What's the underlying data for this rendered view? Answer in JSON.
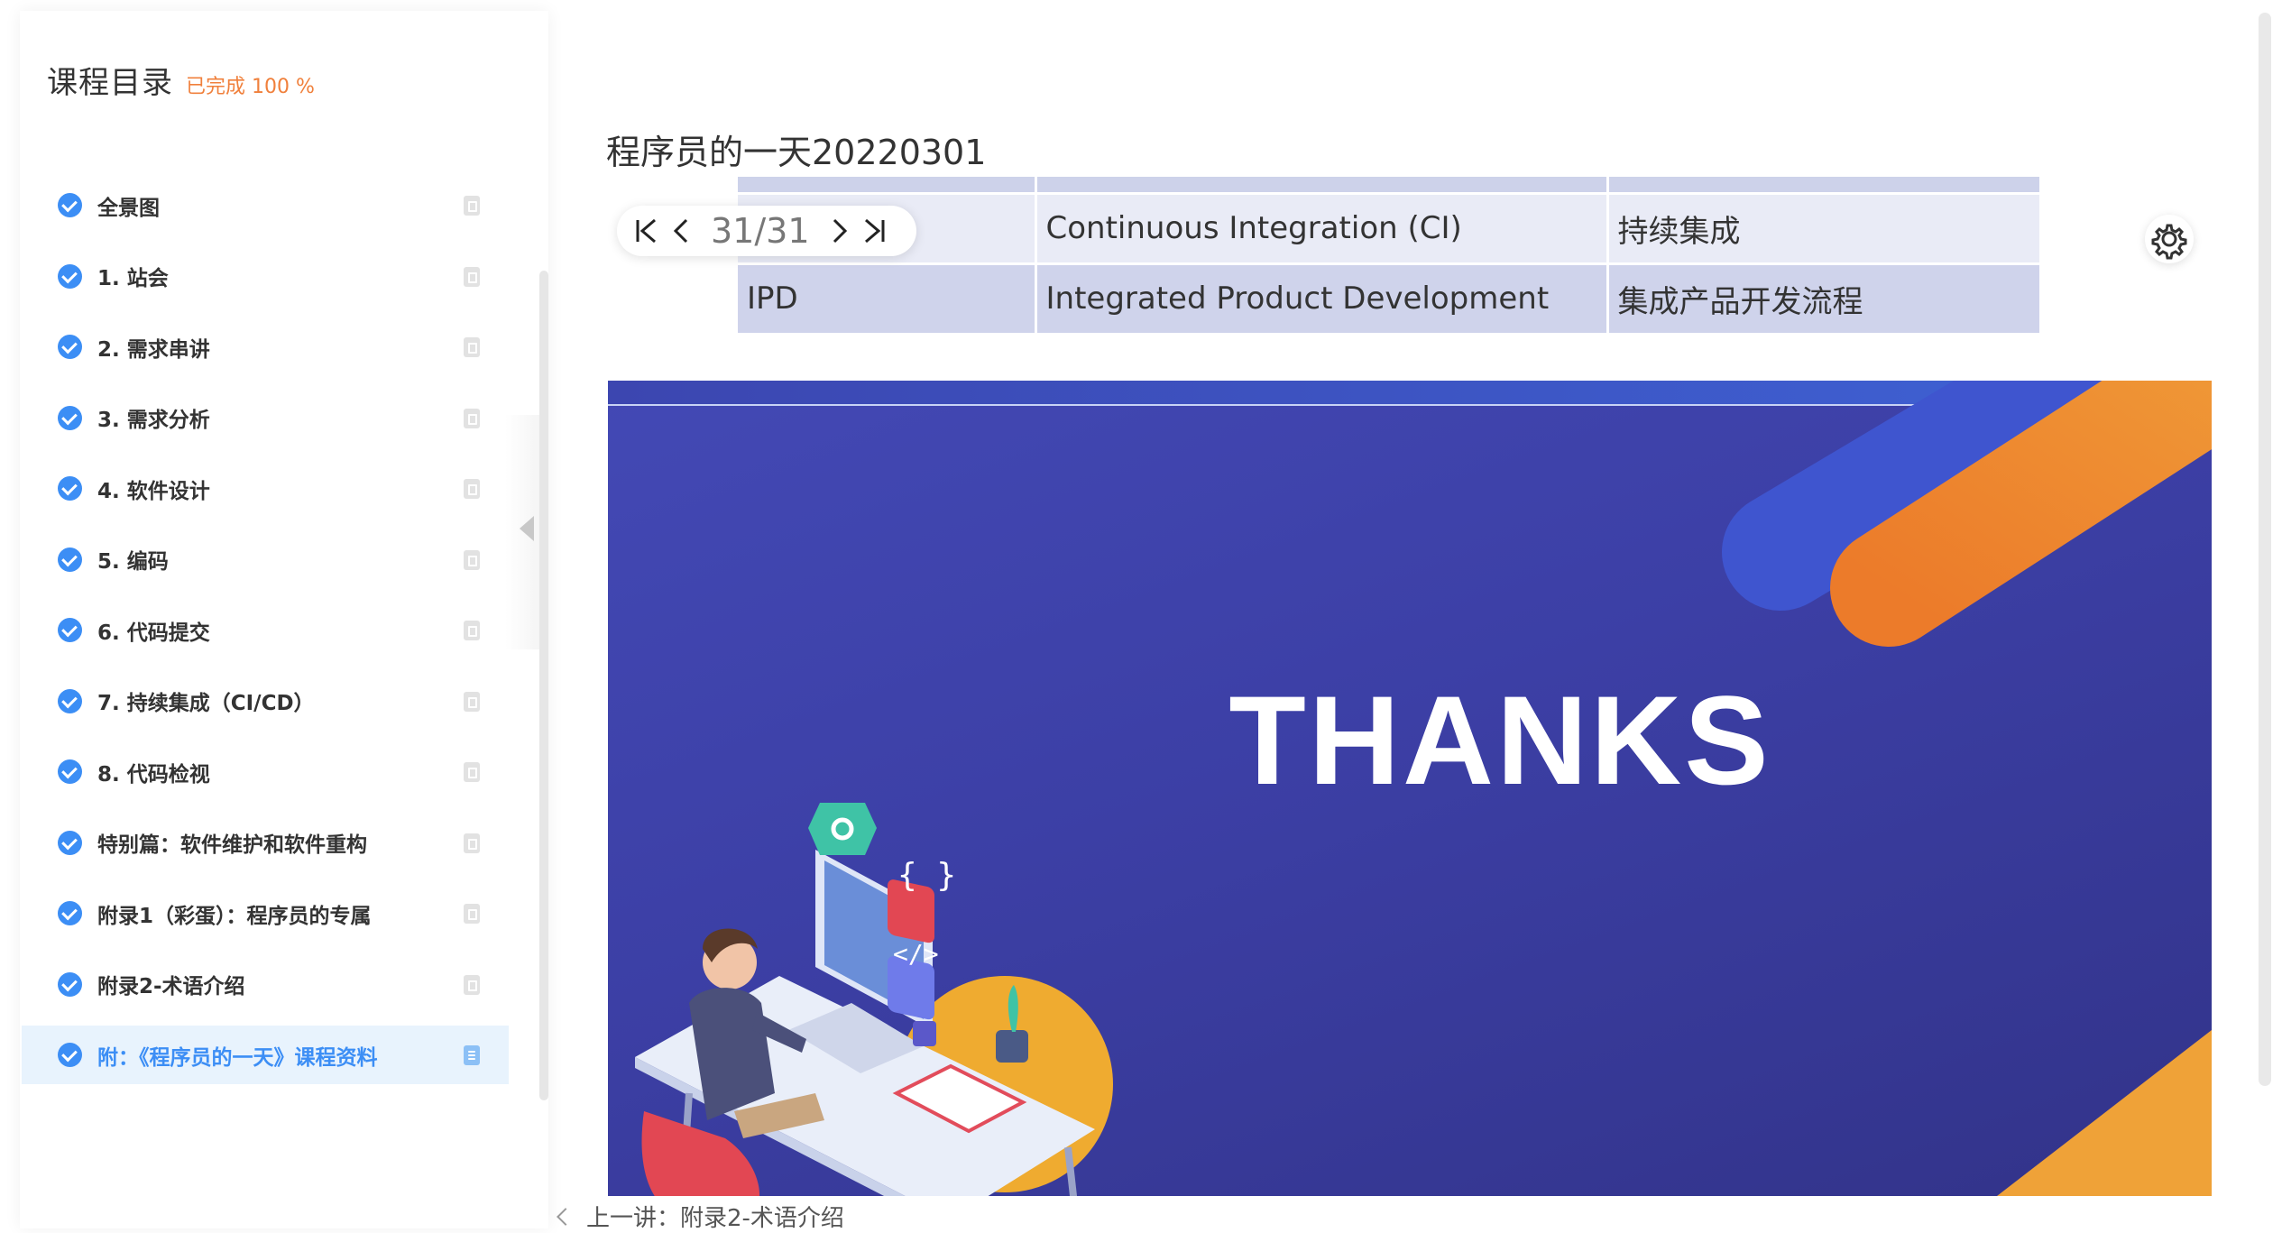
{
  "sidebar": {
    "title": "课程目录",
    "progress": "已完成 100 %",
    "items": [
      {
        "label": "全景图"
      },
      {
        "label": "1. 站会"
      },
      {
        "label": "2. 需求串讲"
      },
      {
        "label": "3. 需求分析"
      },
      {
        "label": "4. 软件设计"
      },
      {
        "label": "5. 编码"
      },
      {
        "label": "6. 代码提交"
      },
      {
        "label": "7. 持续集成（CI/CD）"
      },
      {
        "label": "8. 代码检视"
      },
      {
        "label": "特别篇：软件维护和软件重构"
      },
      {
        "label": "附录1（彩蛋）：程序员的专属"
      },
      {
        "label": "附录2-术语介绍"
      },
      {
        "label": "附：《程序员的一天》课程资料"
      }
    ],
    "active_index": 12
  },
  "main": {
    "title": "程序员的一天20220301",
    "table": {
      "rows": [
        [
          "",
          "Continuous Integration (CI)",
          "持续集成"
        ],
        [
          "IPD",
          "Integrated Product Development",
          "集成产品开发流程"
        ]
      ]
    },
    "pager": {
      "current": "31",
      "separator": "/",
      "total": "31"
    },
    "slide": {
      "text": "THANKS",
      "colors": {
        "background": "#3c3fa5",
        "accent_orange": "#ef8a33",
        "accent_blue": "#3f55cf"
      }
    },
    "prev_lesson": "上一讲：附录2-术语介绍"
  },
  "icons": {
    "check": "check-circle-icon",
    "doc": "document-icon",
    "first": "first-page-icon",
    "prev": "prev-page-icon",
    "next": "next-page-icon",
    "last": "last-page-icon",
    "settings": "gear-icon",
    "back": "chevron-left-icon"
  }
}
